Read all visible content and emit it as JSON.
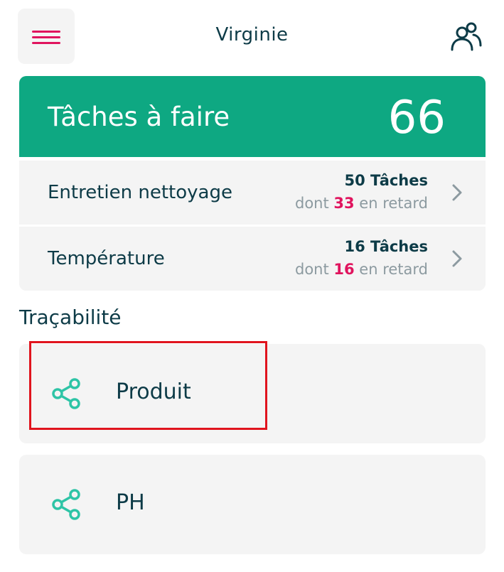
{
  "header": {
    "user_name": "Virginie",
    "menu_icon": "hamburger-menu-icon",
    "users_icon": "users-icon",
    "accent_color": "#e0145e"
  },
  "tasks": {
    "title": "Tâches à faire",
    "total": "66",
    "header_color": "#0ea882",
    "rows": [
      {
        "label": "Entretien nettoyage",
        "count": "50",
        "count_suffix": " Tâches",
        "late_prefix": "dont ",
        "late_count": "33",
        "late_suffix": " en retard",
        "icon": "chevron-right-icon"
      },
      {
        "label": "Température",
        "count": "16",
        "count_suffix": " Tâches",
        "late_prefix": "dont ",
        "late_count": "16",
        "late_suffix": " en retard",
        "icon": "chevron-right-icon"
      }
    ]
  },
  "traceability": {
    "title": "Traçabilité",
    "items": [
      {
        "label": "Produit",
        "icon": "share-icon",
        "highlighted": true
      },
      {
        "label": "PH",
        "icon": "share-icon",
        "highlighted": false
      }
    ],
    "icon_color": "#2ec4a6",
    "highlight_color": "#e0141e"
  }
}
